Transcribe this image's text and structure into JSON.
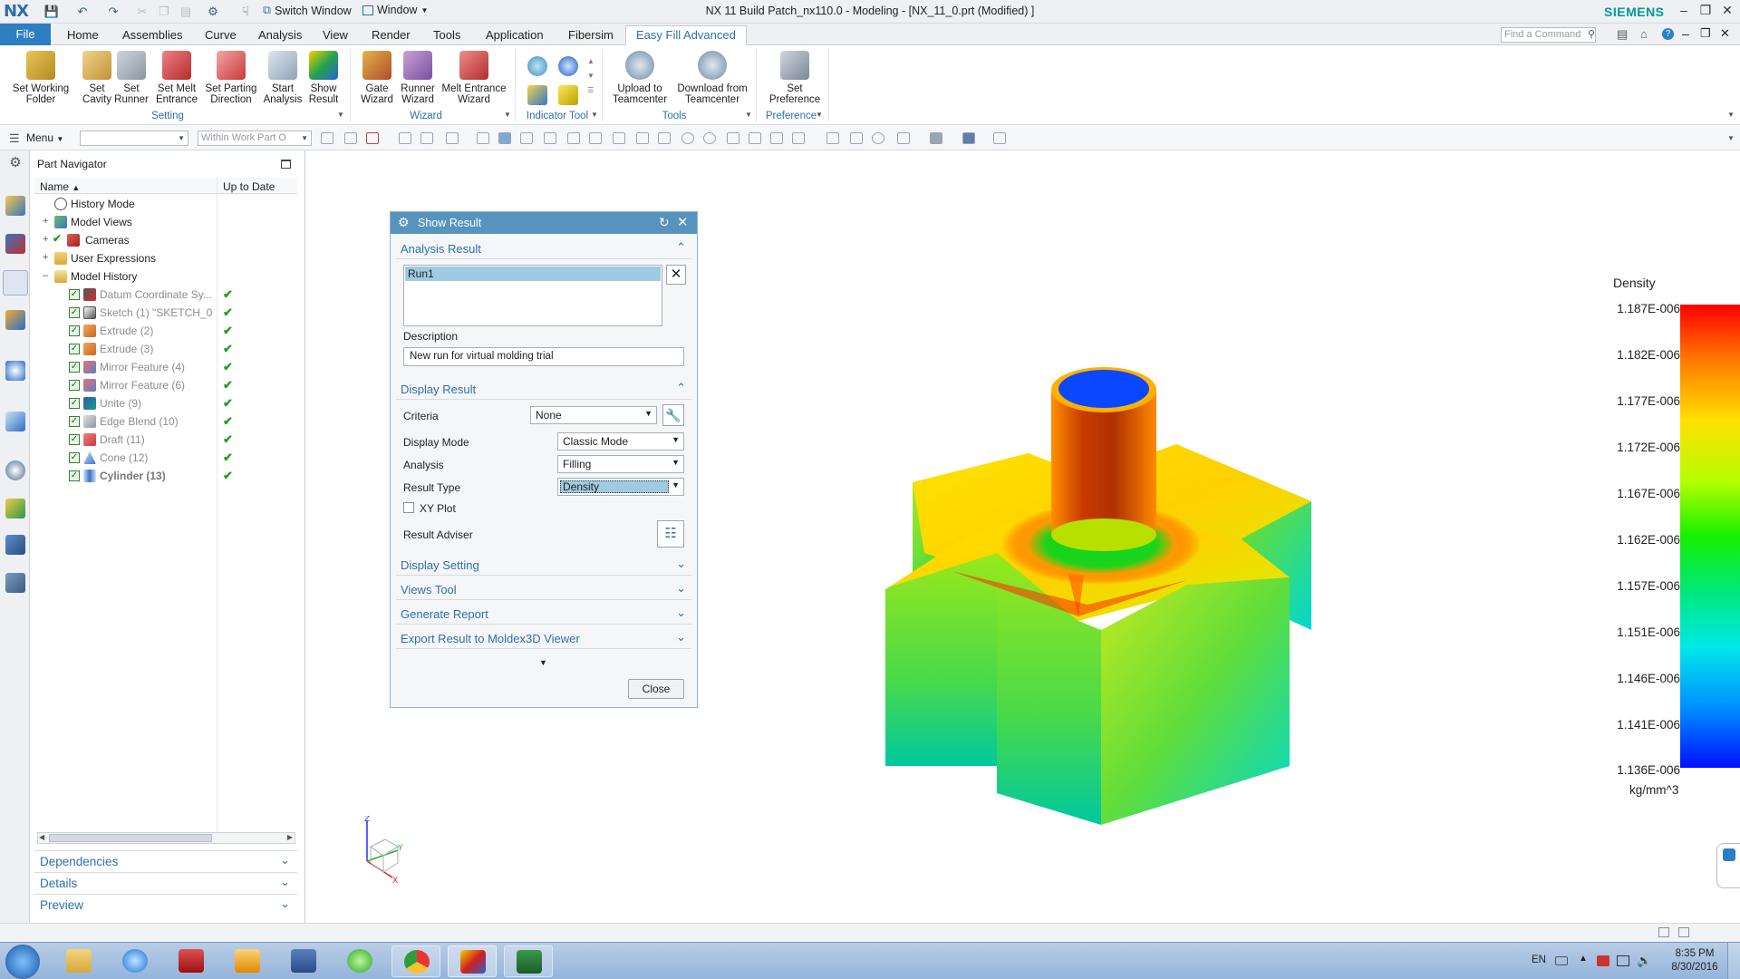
{
  "app": {
    "logo": "NX",
    "title": "NX 11  Build Patch_nx110.0 - Modeling - [NX_11_0.prt (Modified) ]",
    "brand": "SIEMENS",
    "switch_window": "Switch Window",
    "window_menu": "Window"
  },
  "tabs": [
    "File",
    "Home",
    "Assemblies",
    "Curve",
    "Analysis",
    "View",
    "Render",
    "Tools",
    "Application",
    "Fibersim",
    "Easy Fill Advanced"
  ],
  "search_placeholder": "Find a Command",
  "ribbon": {
    "setting": {
      "label": "Setting",
      "buttons": [
        "Set Working\nFolder",
        "Set\nCavity",
        "Set\nRunner",
        "Set Melt\nEntrance",
        "Set Parting\nDirection",
        "Start\nAnalysis",
        "Show\nResult"
      ]
    },
    "wizard": {
      "label": "Wizard",
      "buttons": [
        "Gate\nWizard",
        "Runner\nWizard",
        "Melt Entrance\nWizard"
      ]
    },
    "indicator_label": "Indicator Tool",
    "tools": {
      "label": "Tools",
      "buttons": [
        "Upload to\nTeamcenter",
        "Download from\nTeamcenter"
      ]
    },
    "preference": {
      "label": "Preference",
      "buttons": [
        "Set\nPreference"
      ]
    }
  },
  "cmdbar": {
    "menu": "Menu",
    "scope_placeholder": "Within Work Part O"
  },
  "navigator": {
    "title": "Part Navigator",
    "col_name": "Name",
    "col_uptodate": "Up to Date",
    "top_items": [
      "History Mode",
      "Model Views",
      "Cameras",
      "User Expressions",
      "Model History"
    ],
    "history": [
      "Datum Coordinate Sy...",
      "Sketch (1) \"SKETCH_0...",
      "Extrude (2)",
      "Extrude (3)",
      "Mirror Feature (4)",
      "Mirror Feature (6)",
      "Unite (9)",
      "Edge Blend (10)",
      "Draft (11)",
      "Cone (12)",
      "Cylinder (13)"
    ],
    "panels": [
      "Dependencies",
      "Details",
      "Preview"
    ]
  },
  "dialog": {
    "title": "Show Result",
    "analysis_result": "Analysis Result",
    "run": "Run1",
    "description_label": "Description",
    "description": "New run for virtual molding trial",
    "display_result": "Display Result",
    "criteria_label": "Criteria",
    "criteria": "None",
    "display_mode_label": "Display Mode",
    "display_mode": "Classic Mode",
    "analysis_label": "Analysis",
    "analysis": "Filling",
    "result_type_label": "Result Type",
    "result_type": "Density",
    "xy_plot": "XY Plot",
    "result_adviser": "Result Adviser",
    "collapsed_sections": [
      "Display Setting",
      "Views Tool",
      "Generate Report",
      "Export Result to Moldex3D Viewer"
    ],
    "close": "Close"
  },
  "legend": {
    "title": "Density",
    "ticks": [
      "1.187E-006",
      "1.182E-006",
      "1.177E-006",
      "1.172E-006",
      "1.167E-006",
      "1.162E-006",
      "1.157E-006",
      "1.151E-006",
      "1.146E-006",
      "1.141E-006",
      "1.136E-006"
    ],
    "unit": "kg/mm^3"
  },
  "taskbar": {
    "lang": "EN",
    "time": "8:35 PM",
    "date": "8/30/2016"
  }
}
